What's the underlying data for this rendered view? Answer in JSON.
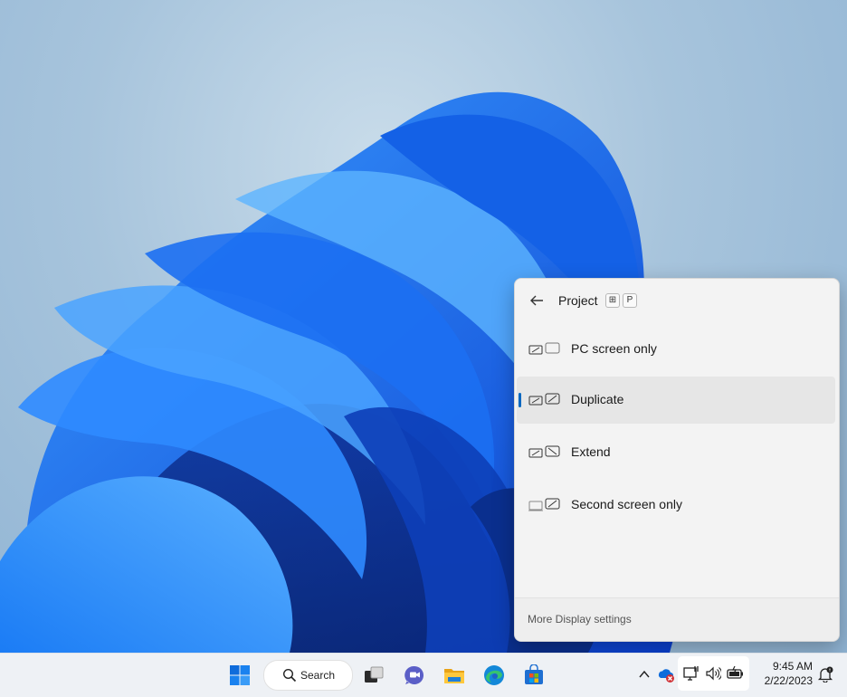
{
  "flyout": {
    "title": "Project",
    "shortcut_keys": [
      "⊞",
      "P"
    ],
    "options": [
      {
        "label": "PC screen only",
        "selected": false
      },
      {
        "label": "Duplicate",
        "selected": true
      },
      {
        "label": "Extend",
        "selected": false
      },
      {
        "label": "Second screen only",
        "selected": false
      }
    ],
    "footer_link": "More Display settings"
  },
  "taskbar": {
    "search_label": "Search",
    "apps": [
      "windows-start-icon",
      "task-view-icon",
      "teams-chat-icon",
      "file-explorer-icon",
      "edge-icon",
      "microsoft-store-icon"
    ],
    "tray": {
      "icons": [
        "chevron-up-icon",
        "onedrive-error-icon",
        "network-icon",
        "volume-icon",
        "battery-icon",
        "notifications-icon"
      ]
    },
    "clock": {
      "time": "9:45 AM",
      "date": "2/22/2023"
    }
  },
  "colors": {
    "accent": "#0067c0",
    "wallpaper_blue": "#1a6fe8"
  }
}
